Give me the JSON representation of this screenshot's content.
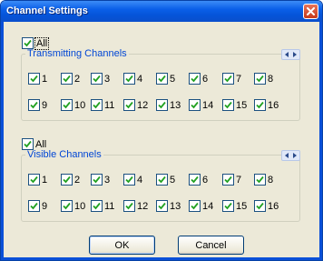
{
  "window": {
    "title": "Channel Settings"
  },
  "transmitting": {
    "all_label": "All",
    "all_checked": true,
    "group_title": "Transmitting Channels",
    "channels": [
      "1",
      "2",
      "3",
      "4",
      "5",
      "6",
      "7",
      "8",
      "9",
      "10",
      "11",
      "12",
      "13",
      "14",
      "15",
      "16"
    ],
    "checked": [
      true,
      true,
      true,
      true,
      true,
      true,
      true,
      true,
      true,
      true,
      true,
      true,
      true,
      true,
      true,
      true
    ]
  },
  "visible": {
    "all_label": "All",
    "all_checked": true,
    "group_title": "Visible Channels",
    "channels": [
      "1",
      "2",
      "3",
      "4",
      "5",
      "6",
      "7",
      "8",
      "9",
      "10",
      "11",
      "12",
      "13",
      "14",
      "15",
      "16"
    ],
    "checked": [
      true,
      true,
      true,
      true,
      true,
      true,
      true,
      true,
      true,
      true,
      true,
      true,
      true,
      true,
      true,
      true
    ]
  },
  "buttons": {
    "ok_label": "OK",
    "cancel_label": "Cancel"
  },
  "icons": {
    "close": "close-icon",
    "checkmark": "checkmark-icon",
    "scroll_left": "arrow-left-icon",
    "scroll_right": "arrow-right-icon"
  },
  "colors": {
    "titlebar": "#0a5fe8",
    "group_title": "#0046d5",
    "dialog_bg": "#ece9d8",
    "checkmark": "#21a121"
  }
}
